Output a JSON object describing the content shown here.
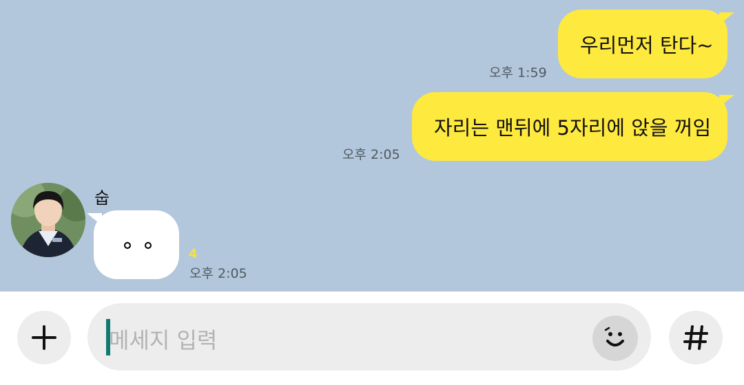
{
  "messages": {
    "outgoing": [
      {
        "text": "우리먼저 탄다~",
        "time": "오후 1:59"
      },
      {
        "text": "자리는 맨뒤에 5자리에 앉을 꺼임",
        "time": "오후 2:05"
      }
    ],
    "incoming": {
      "sender": "숩",
      "unread": "4",
      "time": "오후 2:05"
    }
  },
  "input_bar": {
    "placeholder": "메세지 입력",
    "icons": [
      "plus-icon",
      "smile-icon",
      "hash-icon"
    ]
  },
  "colors": {
    "chat_background": "#b2c7dc",
    "outgoing_bubble": "#fee93f",
    "incoming_bubble": "#ffffff",
    "unread_count": "#f5e23c",
    "caret": "#0f7a6d"
  }
}
